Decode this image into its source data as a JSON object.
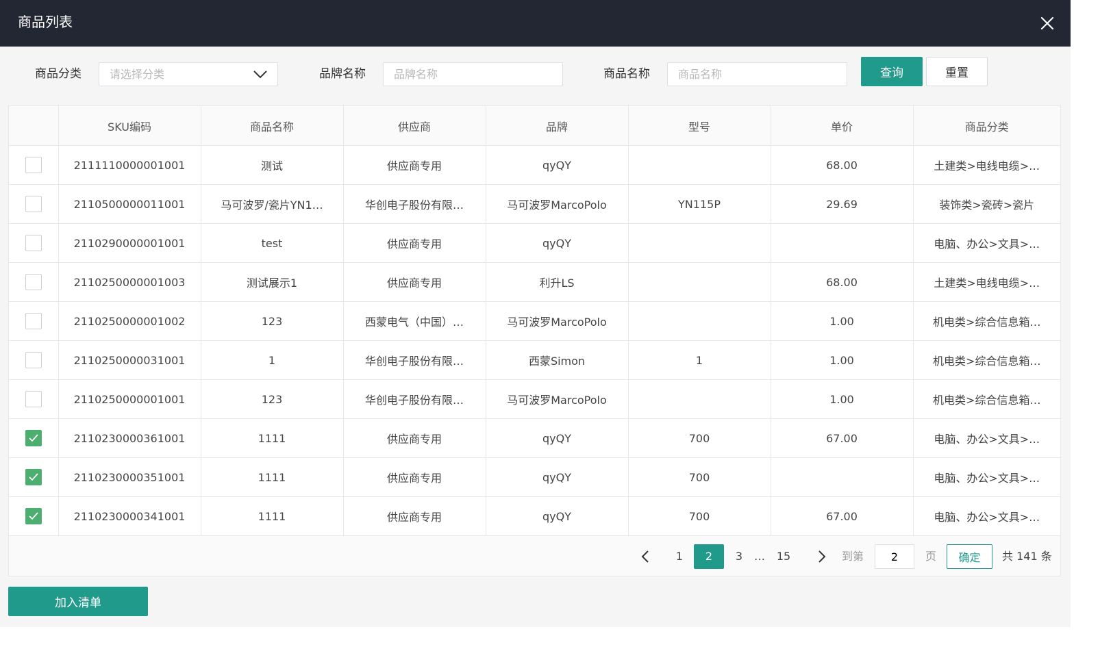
{
  "modal": {
    "title": "商品列表",
    "close_icon": "close-icon"
  },
  "filters": {
    "category_label": "商品分类",
    "category_placeholder": "请选择分类",
    "brand_label": "品牌名称",
    "brand_placeholder": "品牌名称",
    "product_label": "商品名称",
    "product_placeholder": "商品名称",
    "search_label": "查询",
    "reset_label": "重置"
  },
  "table": {
    "columns": [
      "SKU编码",
      "商品名称",
      "供应商",
      "品牌",
      "型号",
      "单价",
      "商品分类"
    ],
    "rows": [
      {
        "checked": false,
        "sku": "2111110000001001",
        "name": "测试",
        "supplier": "供应商专用",
        "brand": "qyQY",
        "model": "",
        "price": "68.00",
        "category": "土建类>电线电缆>…"
      },
      {
        "checked": false,
        "sku": "2110500000011001",
        "name": "马可波罗/瓷片YN1…",
        "supplier": "华创电子股份有限…",
        "brand": "马可波罗MarcoPolo",
        "model": "YN115P",
        "price": "29.69",
        "category": "装饰类>瓷砖>瓷片"
      },
      {
        "checked": false,
        "sku": "2110290000001001",
        "name": "test",
        "supplier": "供应商专用",
        "brand": "qyQY",
        "model": "",
        "price": "",
        "category": "电脑、办公>文具>…"
      },
      {
        "checked": false,
        "sku": "2110250000001003",
        "name": "测试展示1",
        "supplier": "供应商专用",
        "brand": "利升LS",
        "model": "",
        "price": "68.00",
        "category": "土建类>电线电缆>…"
      },
      {
        "checked": false,
        "sku": "2110250000001002",
        "name": "123",
        "supplier": "西蒙电气（中国）…",
        "brand": "马可波罗MarcoPolo",
        "model": "",
        "price": "1.00",
        "category": "机电类>综合信息箱…"
      },
      {
        "checked": false,
        "sku": "2110250000031001",
        "name": "1",
        "supplier": "华创电子股份有限…",
        "brand": "西蒙Simon",
        "model": "1",
        "price": "1.00",
        "category": "机电类>综合信息箱…"
      },
      {
        "checked": false,
        "sku": "2110250000001001",
        "name": "123",
        "supplier": "华创电子股份有限…",
        "brand": "马可波罗MarcoPolo",
        "model": "",
        "price": "1.00",
        "category": "机电类>综合信息箱…"
      },
      {
        "checked": true,
        "sku": "2110230000361001",
        "name": "1111",
        "supplier": "供应商专用",
        "brand": "qyQY",
        "model": "700",
        "price": "67.00",
        "category": "电脑、办公>文具>…"
      },
      {
        "checked": true,
        "sku": "2110230000351001",
        "name": "1111",
        "supplier": "供应商专用",
        "brand": "qyQY",
        "model": "700",
        "price": "",
        "category": "电脑、办公>文具>…"
      },
      {
        "checked": true,
        "sku": "2110230000341001",
        "name": "1111",
        "supplier": "供应商专用",
        "brand": "qyQY",
        "model": "700",
        "price": "67.00",
        "category": "电脑、办公>文具>…"
      }
    ]
  },
  "pagination": {
    "pages": [
      "1",
      "2",
      "3",
      "…",
      "15"
    ],
    "current": "2",
    "goto_label": "到第",
    "goto_value": "2",
    "page_suffix": "页",
    "confirm_label": "确定",
    "total_text": "共 141 条"
  },
  "footer": {
    "add_label": "加入清单"
  },
  "colors": {
    "header_bg": "#222733",
    "primary": "#1f9a8b",
    "checkbox_checked": "#4cae6f"
  }
}
